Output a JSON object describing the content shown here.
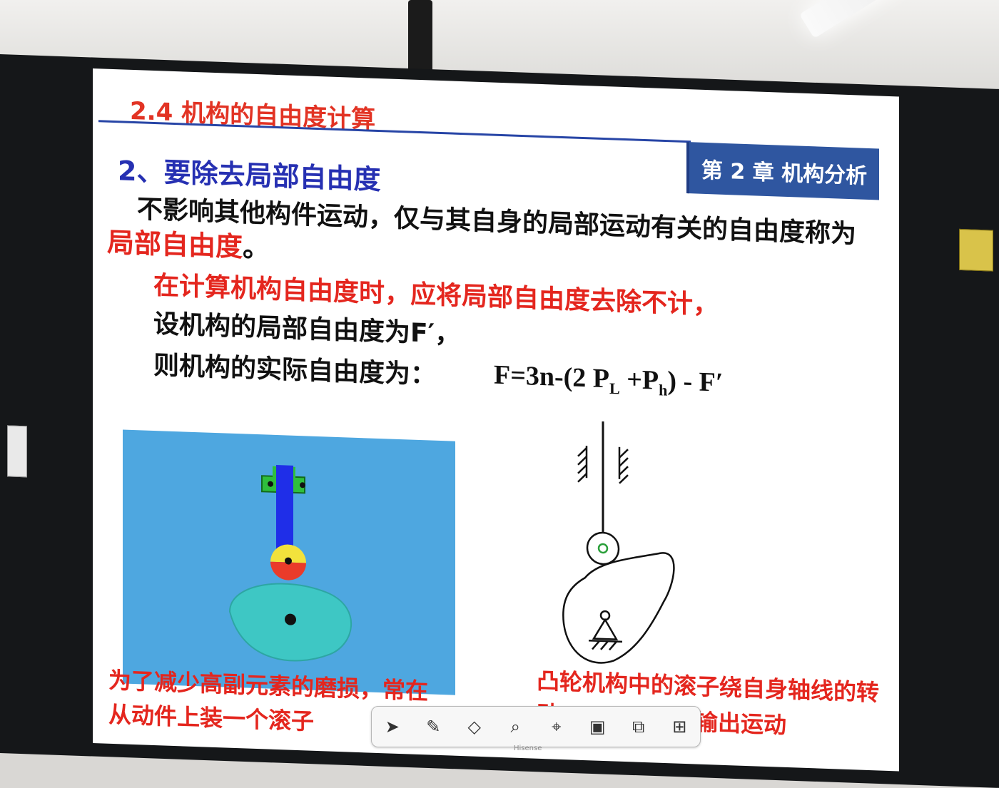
{
  "slide": {
    "title": "2.4 机构的自由度计算",
    "chapter": "第 2 章  机构分析",
    "section": "2、要除去局部自由度",
    "paragraph_line1": "不影响其他构件运动，仅与其自身的局部运动有关的自由度称为",
    "paragraph_line2_red": "局部自由度",
    "paragraph_line2_end": "。",
    "rule_line1": "在计算机构自由度时，应将局部自由度去除不计，",
    "rule_line2": "设机构的局部自由度为F′，",
    "rule_line3": "则机构的实际自由度为：",
    "formula": "F=3n-(2 P_L +P_h) - F′",
    "caption_left_line1": "为了减少高副元素的磨损，常在",
    "caption_left_line2": "从动件上装一个滚子",
    "caption_right_line1": "凸轮机构中的滚子绕自身轴线的转动",
    "caption_right_line2": "不影响从动件的输出运动"
  },
  "toolbar": {
    "tools": [
      "pointer-icon",
      "pen-icon",
      "eraser-icon",
      "search-icon",
      "pin-icon",
      "board-icon",
      "camera-icon",
      "grid-icon"
    ]
  },
  "brand": "Hisense",
  "colors": {
    "title_red": "#e23324",
    "section_blue": "#2630b2",
    "chapter_blue": "#2f56a0",
    "scene_blue": "#4ea7e0",
    "cam_teal": "#3ec7c4"
  }
}
